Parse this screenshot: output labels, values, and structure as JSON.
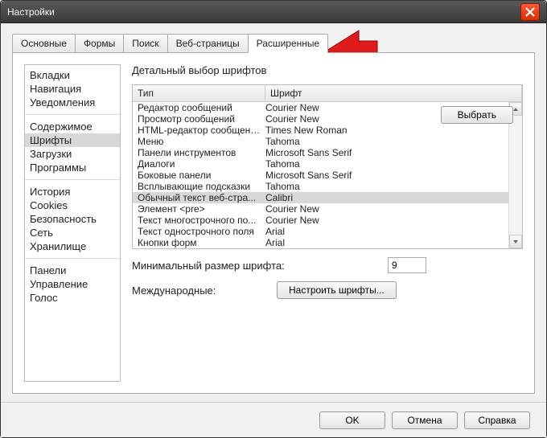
{
  "window": {
    "title": "Настройки"
  },
  "tabs": [
    {
      "label": "Основные",
      "active": false
    },
    {
      "label": "Формы",
      "active": false
    },
    {
      "label": "Поиск",
      "active": false
    },
    {
      "label": "Веб-страницы",
      "active": false
    },
    {
      "label": "Расширенные",
      "active": true
    }
  ],
  "sidebar": {
    "groups": [
      [
        "Вкладки",
        "Навигация",
        "Уведомления"
      ],
      [
        "Содержимое",
        "Шрифты",
        "Загрузки",
        "Программы"
      ],
      [
        "История",
        "Cookies",
        "Безопасность",
        "Сеть",
        "Хранилище"
      ],
      [
        "Панели",
        "Управление",
        "Голос"
      ]
    ],
    "selected": "Шрифты"
  },
  "section_title": "Детальный выбор шрифтов",
  "columns": {
    "type": "Тип",
    "font": "Шрифт"
  },
  "font_rows": [
    {
      "type": "Редактор сообщений",
      "font": "Courier New"
    },
    {
      "type": "Просмотр сообщений",
      "font": "Courier New"
    },
    {
      "type": "HTML-редактор сообщений",
      "font": "Times New Roman"
    },
    {
      "type": "Меню",
      "font": "Tahoma"
    },
    {
      "type": "Панели инструментов",
      "font": "Microsoft Sans Serif"
    },
    {
      "type": "Диалоги",
      "font": "Tahoma"
    },
    {
      "type": "Боковые панели",
      "font": "Microsoft Sans Serif"
    },
    {
      "type": "Всплывающие подсказки",
      "font": "Tahoma"
    },
    {
      "type": "Обычный текст веб-стра...",
      "font": "Calibri",
      "selected": true
    },
    {
      "type": "Элемент <pre>",
      "font": "Courier New"
    },
    {
      "type": "Текст многострочного по...",
      "font": "Courier New"
    },
    {
      "type": "Текст однострочного поля",
      "font": "Arial"
    },
    {
      "type": "Кнопки форм",
      "font": "Arial"
    }
  ],
  "buttons": {
    "select": "Выбрать",
    "configure_fonts": "Настроить шрифты...",
    "ok": "OK",
    "cancel": "Отмена",
    "help": "Справка"
  },
  "min_font": {
    "label": "Минимальный размер шрифта:",
    "value": "9"
  },
  "intl": {
    "label": "Международные:"
  }
}
